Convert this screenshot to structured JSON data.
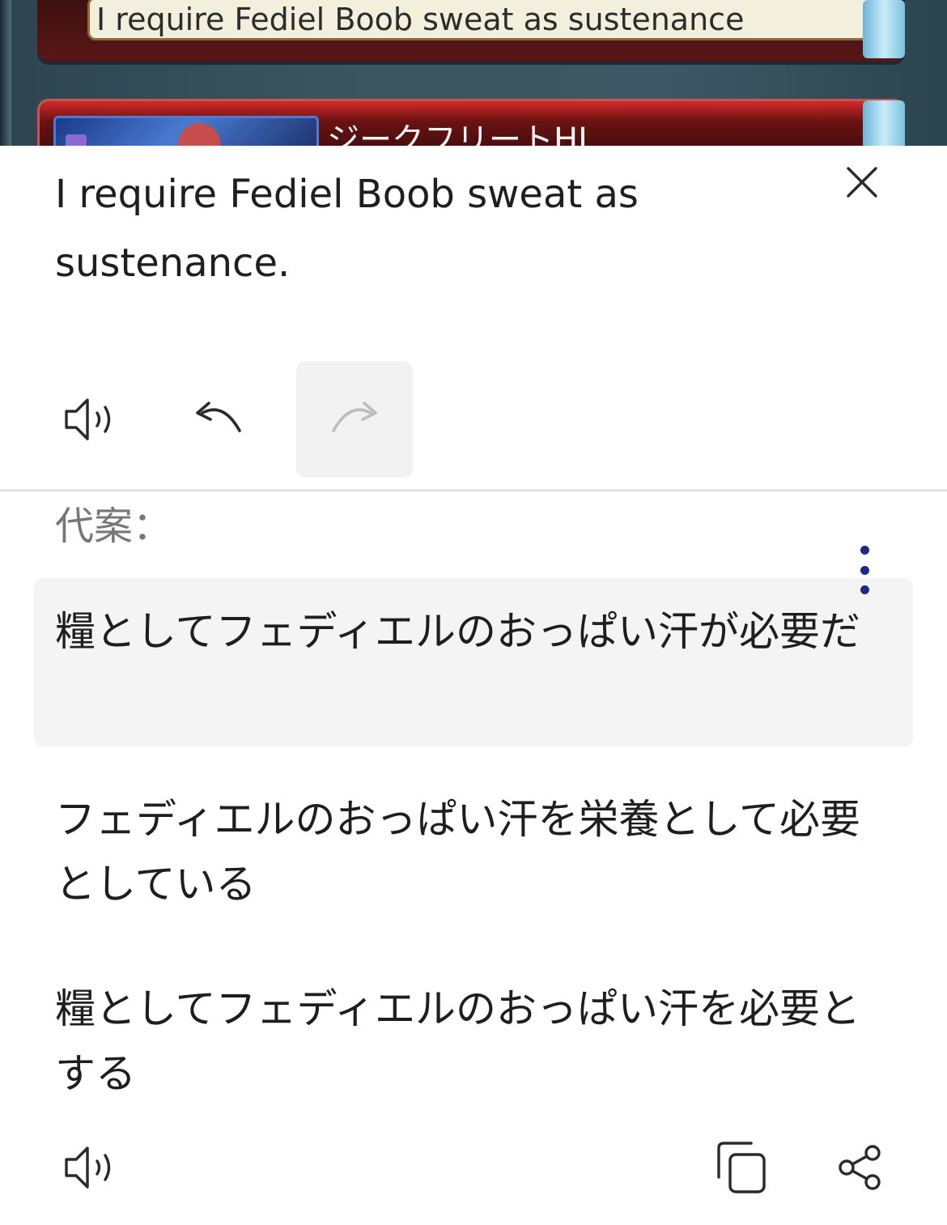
{
  "background_app": {
    "chat_text": "I require Fediel Boob sweat as sustenance",
    "card_title": "ジークフリートHL"
  },
  "translation": {
    "source_text": "I require Fediel Boob sweat as sustenance.",
    "alternatives_label": "代案：",
    "alternatives": [
      "糧としてフェディエルのおっぱい汗が必要だ",
      "フェディエルのおっぱい汗を栄養として必要としている",
      "糧としてフェディエルのおっぱい汗を必要とする"
    ],
    "selected_index": 0
  },
  "icons": {
    "close": "close-icon",
    "speak": "speaker-icon",
    "undo": "undo-icon",
    "redo": "redo-icon",
    "more": "more-vertical-icon",
    "copy": "copy-icon",
    "share": "share-icon"
  },
  "colors": {
    "accent_dots": "#1a2a8a",
    "selected_bg": "#f4f4f4",
    "secondary_text": "#777777"
  }
}
